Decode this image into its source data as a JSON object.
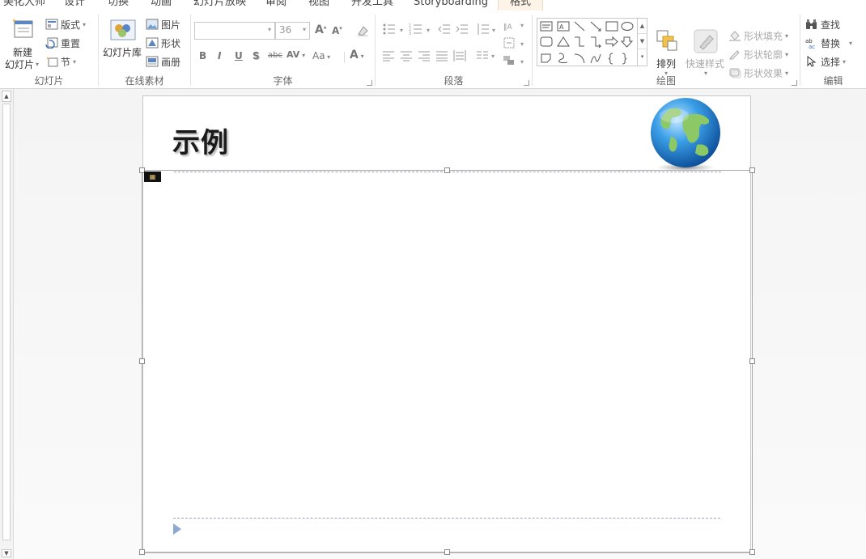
{
  "tabs": [
    {
      "label": "美化大师"
    },
    {
      "label": "设计"
    },
    {
      "label": "切换"
    },
    {
      "label": "动画"
    },
    {
      "label": "幻灯片放映"
    },
    {
      "label": "审阅"
    },
    {
      "label": "视图"
    },
    {
      "label": "开发工具"
    },
    {
      "label": "Storyboarding"
    },
    {
      "label": "格式",
      "active": true
    }
  ],
  "ribbon": {
    "slides_group": {
      "label": "幻灯片",
      "new_slide_line1": "新建",
      "new_slide_line2": "幻灯片",
      "layout": "版式",
      "reset": "重置",
      "section": "节"
    },
    "online_group": {
      "label": "在线素材",
      "library": "幻灯片库",
      "picture": "图片",
      "shape": "形状",
      "album": "画册"
    },
    "font_group": {
      "label": "字体",
      "font_name": "",
      "font_size": "36",
      "grow": "A",
      "shrink": "A",
      "bold": "B",
      "italic": "I",
      "underline": "U",
      "shadow": "S",
      "strike": "abc",
      "spacing": "AV",
      "case": "Aa",
      "color": "A"
    },
    "paragraph_group": {
      "label": "段落"
    },
    "drawing_group": {
      "label": "绘图",
      "arrange": "排列",
      "quick_styles": "快速样式",
      "shape_fill": "形状填充",
      "shape_outline": "形状轮廓",
      "shape_effects": "形状效果"
    },
    "editing_group": {
      "label": "编辑",
      "find": "查找",
      "replace": "替换",
      "select": "选择"
    }
  },
  "slide": {
    "title": "示例"
  },
  "colors": {
    "active_tab_bg": "#fdf3e6",
    "globe_ocean": "#2f8fd8",
    "globe_land": "#8cc866",
    "play_marker": "#8fa8d0"
  }
}
